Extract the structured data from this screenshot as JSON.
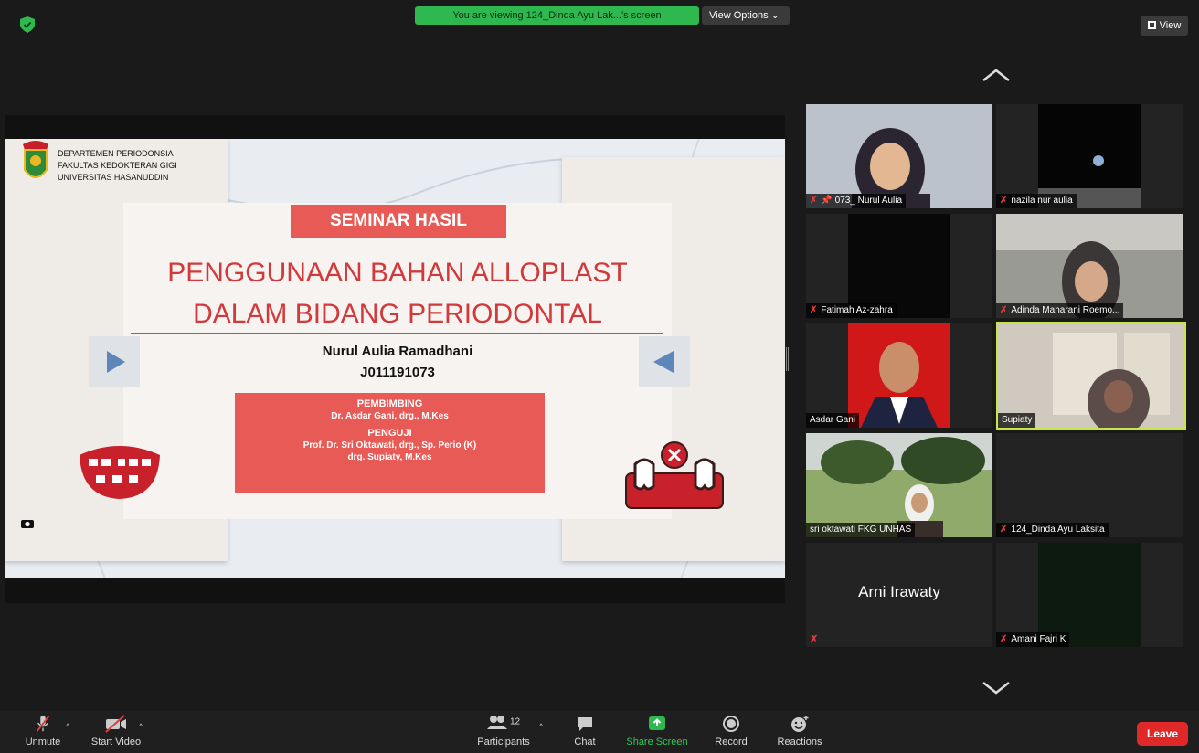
{
  "banner": {
    "viewing_text": "You are viewing 124_Dinda Ayu Lak...'s screen",
    "view_options_label": "View Options ⌄",
    "view_label": "View"
  },
  "slide": {
    "institution": [
      "DEPARTEMEN PERIODONSIA",
      "FAKULTAS KEDOKTERAN GIGI",
      "UNIVERSITAS HASANUDDIN"
    ],
    "seminar_label": "SEMINAR HASIL",
    "title_line1": "PENGGUNAAN BAHAN ALLOPLAST",
    "title_line2": "DALAM BIDANG PERIODONTAL",
    "author": "Nurul Aulia Ramadhani",
    "nim": "J011191073",
    "pembimbing_head": "PEMBIMBING",
    "pembimbing_name": "Dr. Asdar Gani, drg., M.Kes",
    "penguji_head": "PENGUJI",
    "penguji_name1": "Prof. Dr. Sri Oktawati, drg., Sp. Perio (K)",
    "penguji_name2": "drg. Supiaty, M.Kes"
  },
  "participants": {
    "tiles": [
      {
        "name": "073_ Nurul Aulia",
        "muted": true,
        "pinned": true
      },
      {
        "name": "nazila nur aulia",
        "muted": true
      },
      {
        "name": "Fatimah Az-zahra",
        "muted": true
      },
      {
        "name": "Adinda Maharani Roemo...",
        "muted": true
      },
      {
        "name": "Asdar Gani",
        "muted": false
      },
      {
        "name": "Supiaty",
        "muted": false,
        "active_speaker": true
      },
      {
        "name": "sri oktawati FKG UNHAS",
        "muted": false
      },
      {
        "name": "124_Dinda Ayu Laksita",
        "muted": true
      },
      {
        "name": "Arni Irawaty",
        "muted": true,
        "video_off": true
      },
      {
        "name": "Amani Fajri K",
        "muted": true
      }
    ]
  },
  "toolbar": {
    "unmute_label": "Unmute",
    "start_video_label": "Start Video",
    "participants_label": "Participants",
    "participants_count": "12",
    "chat_label": "Chat",
    "share_screen_label": "Share Screen",
    "record_label": "Record",
    "reactions_label": "Reactions",
    "leave_label": "Leave"
  },
  "colors": {
    "banner_green": "#2fb84f",
    "slide_red": "#e85a55",
    "title_red": "#d2393a",
    "leave_red": "#e02828",
    "active_speaker": "#c8e64a"
  }
}
